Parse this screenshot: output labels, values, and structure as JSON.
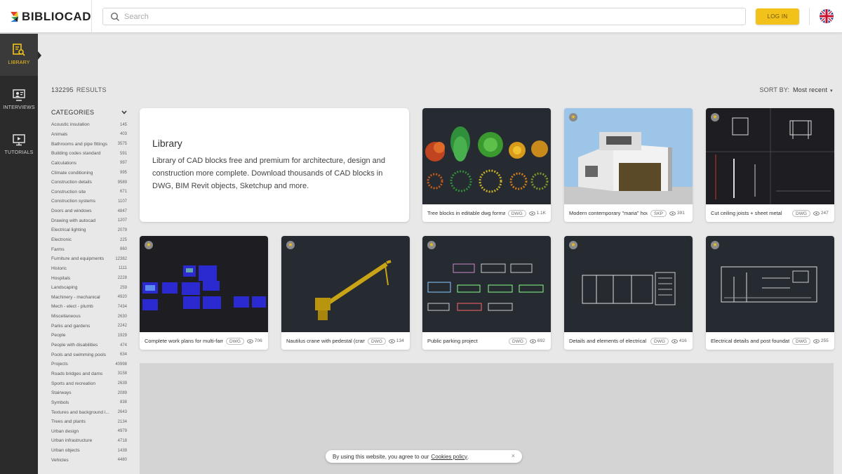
{
  "header": {
    "logo_text": "BIBLIOCAD",
    "search_placeholder": "Search",
    "login_label": "LOG IN",
    "accent_color": "#f2c21b"
  },
  "nav": [
    {
      "label": "LIBRARY",
      "icon": "library-icon",
      "active": true
    },
    {
      "label": "INTERVIEWS",
      "icon": "interviews-icon",
      "active": false
    },
    {
      "label": "TUTORIALS",
      "icon": "tutorials-icon",
      "active": false
    }
  ],
  "results": {
    "count": "132295",
    "label": "RESULTS"
  },
  "sort": {
    "label": "SORT BY:",
    "value": "Most recent"
  },
  "categories": {
    "title": "CATEGORIES",
    "items": [
      {
        "name": "Acoustic insulation",
        "count": "145"
      },
      {
        "name": "Animals",
        "count": "403"
      },
      {
        "name": "Bathrooms and pipe fittings",
        "count": "3575"
      },
      {
        "name": "Building codes standard",
        "count": "591"
      },
      {
        "name": "Calculations",
        "count": "997"
      },
      {
        "name": "Climate conditioning",
        "count": "995"
      },
      {
        "name": "Construction details",
        "count": "9589"
      },
      {
        "name": "Construction site",
        "count": "671"
      },
      {
        "name": "Construction systems",
        "count": "1107"
      },
      {
        "name": "Doors and windows",
        "count": "4847"
      },
      {
        "name": "Drawing with autocad",
        "count": "1207"
      },
      {
        "name": "Electrical lighting",
        "count": "2079"
      },
      {
        "name": "Electronic",
        "count": "225"
      },
      {
        "name": "Farms",
        "count": "860"
      },
      {
        "name": "Furniture and equipments",
        "count": "12382"
      },
      {
        "name": "Historic",
        "count": "1111"
      },
      {
        "name": "Hospitals",
        "count": "2228"
      },
      {
        "name": "Landscaping",
        "count": "259"
      },
      {
        "name": "Machinery - mechanical",
        "count": "4920"
      },
      {
        "name": "Mech - elect - plumb",
        "count": "7434"
      },
      {
        "name": "Miscellaneous",
        "count": "2630"
      },
      {
        "name": "Parks and gardens",
        "count": "2242"
      },
      {
        "name": "People",
        "count": "1929"
      },
      {
        "name": "People with disabilities",
        "count": "474"
      },
      {
        "name": "Pools and swimming pools",
        "count": "634"
      },
      {
        "name": "Projects",
        "count": "40998"
      },
      {
        "name": "Roads bridges and dams",
        "count": "3158"
      },
      {
        "name": "Sports and recreation",
        "count": "2639"
      },
      {
        "name": "Stairways",
        "count": "2089"
      },
      {
        "name": "Symbols",
        "count": "838"
      },
      {
        "name": "Textures and background i...",
        "count": "2643"
      },
      {
        "name": "Trees and plants",
        "count": "2134"
      },
      {
        "name": "Urban design",
        "count": "4979"
      },
      {
        "name": "Urban infrastructure",
        "count": "4718"
      },
      {
        "name": "Urban objects",
        "count": "1439"
      },
      {
        "name": "Vehicles",
        "count": "4480"
      }
    ]
  },
  "intro": {
    "title": "Library",
    "text": "Library of CAD blocks free and premium for architecture, design and construction more complete. Download thousands of CAD blocks in DWG, BIM Revit objects, Sketchup and more."
  },
  "cards": [
    {
      "title": "Tree blocks in editable dwg format",
      "format": "DWG",
      "views": "1.1K",
      "premium": false
    },
    {
      "title": "Modern contemporary \"maria\" house",
      "format": "SKP",
      "views": "391",
      "premium": true
    },
    {
      "title": "Cut ceiling joists + sheet metal",
      "format": "DWG",
      "views": "247",
      "premium": true
    },
    {
      "title": "Complete work plans for multi-family",
      "format": "DWG",
      "views": "706",
      "premium": true
    },
    {
      "title": "Nautilus crane with pedestal (crane)",
      "format": "DWG",
      "views": "134",
      "premium": true
    },
    {
      "title": "Public parking project",
      "format": "DWG",
      "views": "692",
      "premium": true
    },
    {
      "title": "Details and elements of electrical",
      "format": "DWG",
      "views": "416",
      "premium": true
    },
    {
      "title": "Electrical details and post foundation",
      "format": "DWG",
      "views": "255",
      "premium": true
    }
  ],
  "cookie": {
    "text": "By using this website, you agree to our",
    "link": "Cookies policy",
    "suffix": ".",
    "close": "×"
  }
}
